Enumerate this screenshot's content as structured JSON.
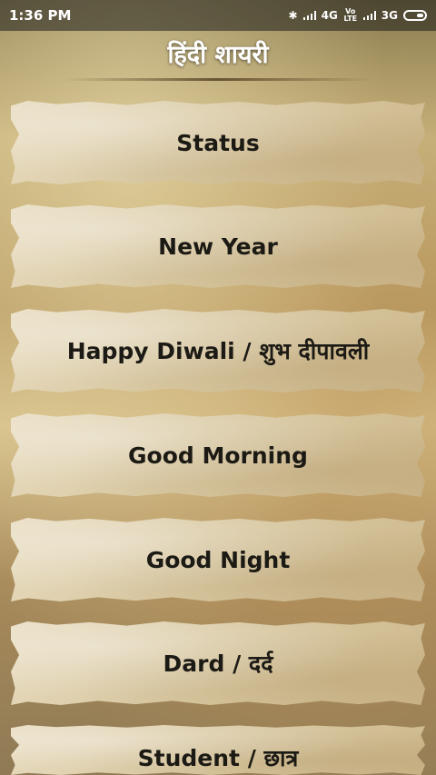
{
  "status_bar": {
    "time": "1:36 PM",
    "network1": "4G",
    "volte": "Vo LTE",
    "network2": "3G",
    "icons": [
      "bluetooth-icon",
      "signal-icon",
      "signal-icon",
      "battery-icon"
    ]
  },
  "app": {
    "title": "हिंदी शायरी"
  },
  "menu": {
    "items": [
      {
        "label": "Status"
      },
      {
        "label": "New Year"
      },
      {
        "label": "Happy Diwali / शुभ दीपावली"
      },
      {
        "label": "Good Morning"
      },
      {
        "label": "Good Night"
      },
      {
        "label": "Dard / दर्द"
      },
      {
        "label": "Student / छात्र"
      }
    ]
  }
}
